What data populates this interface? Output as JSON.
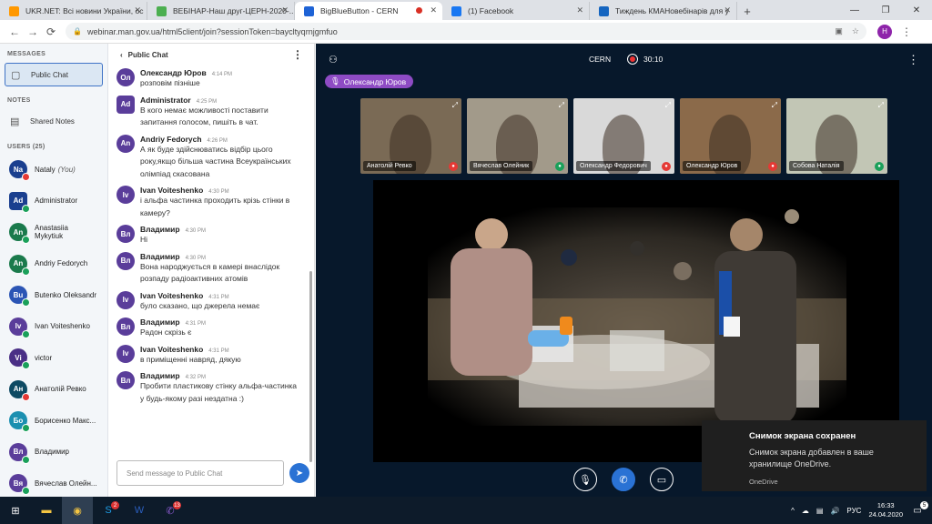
{
  "browser": {
    "tabs": [
      {
        "label": "UKR.NET: Всі новини України, ос",
        "fav": "#ff9800"
      },
      {
        "label": "ВЕБІНАР-Наш друг-ЦЕРН-2020-...",
        "fav": "#4caf50"
      },
      {
        "label": "BigBlueButton - CERN",
        "fav": "#1e63d6"
      },
      {
        "label": "(1) Facebook",
        "fav": "#1877f2"
      },
      {
        "label": "Тиждень КМАНовебінарів для у",
        "fav": "#1565c0"
      }
    ],
    "url": "webinar.man.gov.ua/html5client/join?sessionToken=baycltyqrnjgmfuo",
    "profile_initial": "H"
  },
  "sidebar": {
    "messages_heading": "MESSAGES",
    "public_chat": "Public Chat",
    "notes_heading": "NOTES",
    "shared_notes": "Shared Notes",
    "users_heading": "USERS (25)",
    "users": [
      {
        "abbr": "Na",
        "name": "Nataly",
        "suffix": "(You)",
        "color": "#1a3f8f",
        "status": "#e53935",
        "shape": "round"
      },
      {
        "abbr": "Ad",
        "name": "Administrator",
        "suffix": "",
        "color": "#1a3f8f",
        "status": "#1aa05a",
        "shape": "square"
      },
      {
        "abbr": "An",
        "name": "Anastasiia Mykytiuk",
        "suffix": "",
        "color": "#1a7a4c",
        "status": "#1aa05a",
        "shape": "round"
      },
      {
        "abbr": "An",
        "name": "Andriy Fedorych",
        "suffix": "",
        "color": "#1a7a4c",
        "status": "#1aa05a",
        "shape": "round"
      },
      {
        "abbr": "Bu",
        "name": "Butenko Oleksandr",
        "suffix": "",
        "color": "#2b55b5",
        "status": "#1aa05a",
        "shape": "round"
      },
      {
        "abbr": "Iv",
        "name": "Ivan Voiteshenko",
        "suffix": "",
        "color": "#5a3d9a",
        "status": "#1aa05a",
        "shape": "round"
      },
      {
        "abbr": "Vi",
        "name": "victor",
        "suffix": "",
        "color": "#4a2f86",
        "status": "#1aa05a",
        "shape": "round"
      },
      {
        "abbr": "Ан",
        "name": "Анатолій Ревко",
        "suffix": "",
        "color": "#0e4a63",
        "status": "#e53935",
        "shape": "round"
      },
      {
        "abbr": "Бо",
        "name": "Борисенко Макс...",
        "suffix": "",
        "color": "#1b8fb0",
        "status": "#1aa05a",
        "shape": "round"
      },
      {
        "abbr": "Вл",
        "name": "Владимир",
        "suffix": "",
        "color": "#5a3d9a",
        "status": "#1aa05a",
        "shape": "round"
      },
      {
        "abbr": "Вя",
        "name": "Вячеслав Олейн...",
        "suffix": "",
        "color": "#5a3d9a",
        "status": "#1aa05a",
        "shape": "round"
      }
    ]
  },
  "chat": {
    "back_label": "Public Chat",
    "input_placeholder": "Send message to Public Chat",
    "messages": [
      {
        "abbr": "Ол",
        "name": "Олександр Юров",
        "time": "4:14 PM",
        "text": "розповім пізніше",
        "color": "#5a3d9a"
      },
      {
        "abbr": "Ad",
        "name": "Administrator",
        "time": "4:25 PM",
        "text": "В кого немає можливості поставити запитання голосом, пишіть в чат.",
        "color": "#5a3d9a"
      },
      {
        "abbr": "An",
        "name": "Andriy Fedorych",
        "time": "4:26 PM",
        "text": "А як буде здійснюватись відбір цього року,якщо більша частина Всеукраїнських олімпіад скасована",
        "color": "#5a3d9a"
      },
      {
        "abbr": "Iv",
        "name": "Ivan Voiteshenko",
        "time": "4:30 PM",
        "text": "і альфа частинка проходить крізь стінки в камеру?",
        "color": "#5a3d9a"
      },
      {
        "abbr": "Вл",
        "name": "Владимир",
        "time": "4:30 PM",
        "text": "Ні",
        "color": "#5a3d9a"
      },
      {
        "abbr": "Вл",
        "name": "Владимир",
        "time": "4:30 PM",
        "text": "Вона народжується в камері внаслідок розпаду радіоактивних атомів",
        "color": "#5a3d9a"
      },
      {
        "abbr": "Iv",
        "name": "Ivan Voiteshenko",
        "time": "4:31 PM",
        "text": "було сказано, що джерела немає",
        "color": "#5a3d9a"
      },
      {
        "abbr": "Вл",
        "name": "Владимир",
        "time": "4:31 PM",
        "text": "Радон скрізь є",
        "color": "#5a3d9a"
      },
      {
        "abbr": "Iv",
        "name": "Ivan Voiteshenko",
        "time": "4:31 PM",
        "text": "в приміщенні навряд, дякую",
        "color": "#5a3d9a"
      },
      {
        "abbr": "Вл",
        "name": "Владимир",
        "time": "4:32 PM",
        "text": "Пробити пластикову стінку альфа-частинка у будь-якому разі нездатна :)",
        "color": "#5a3d9a"
      }
    ]
  },
  "meeting": {
    "title": "CERN",
    "record_time": "30:10",
    "talking": "Олександр Юров",
    "thumbnails": [
      {
        "name": "Анатолій Ревко",
        "bg": "#7a6a55",
        "mic": "#e53935"
      },
      {
        "name": "Вячеслав Олейник",
        "bg": "#a29a8a",
        "mic": "#1aa05a"
      },
      {
        "name": "Олександр Федорович",
        "bg": "#d9d9d9",
        "mic": "#e53935"
      },
      {
        "name": "Олександр Юров",
        "bg": "#8b6a4a",
        "mic": "#e53935"
      },
      {
        "name": "Собова Наталія",
        "bg": "#c2c6b5",
        "mic": "#1aa05a"
      }
    ]
  },
  "toast": {
    "title": "Снимок экрана сохранен",
    "body": "Снимок экрана добавлен в ваше хранилище OneDrive.",
    "source": "OneDrive"
  },
  "taskbar": {
    "lang": "РУС",
    "time": "16:33",
    "date": "24.04.2020",
    "notifications": "5",
    "badges": {
      "skype": "2",
      "viber": "13"
    }
  }
}
